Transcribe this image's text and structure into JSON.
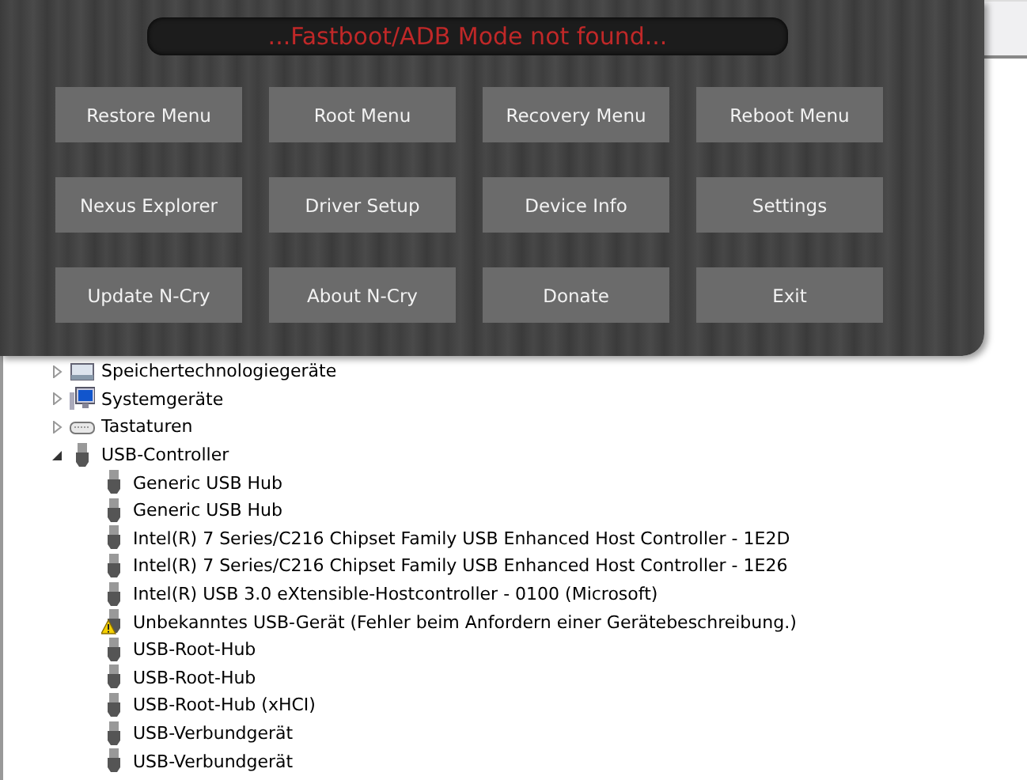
{
  "status": "...Fastboot/ADB Mode not found...",
  "buttons": [
    "Restore Menu",
    "Root Menu",
    "Recovery Menu",
    "Reboot Menu",
    "Nexus Explorer",
    "Driver Setup",
    "Device Info",
    "Settings",
    "Update N-Cry",
    "About N-Cry",
    "Donate",
    "Exit"
  ],
  "tree": [
    {
      "label": "Speichertechnologiegeräte",
      "kind": "storage",
      "expanded": false
    },
    {
      "label": "Systemgeräte",
      "kind": "system",
      "expanded": false
    },
    {
      "label": "Tastaturen",
      "kind": "keyboard",
      "expanded": false
    },
    {
      "label": "USB-Controller",
      "kind": "usb",
      "expanded": true,
      "children": [
        {
          "label": "Generic USB Hub",
          "warning": false
        },
        {
          "label": "Generic USB Hub",
          "warning": false
        },
        {
          "label": "Intel(R) 7 Series/C216 Chipset Family USB Enhanced Host Controller - 1E2D",
          "warning": false
        },
        {
          "label": "Intel(R) 7 Series/C216 Chipset Family USB Enhanced Host Controller - 1E26",
          "warning": false
        },
        {
          "label": "Intel(R) USB 3.0 eXtensible-Hostcontroller - 0100 (Microsoft)",
          "warning": false
        },
        {
          "label": "Unbekanntes USB-Gerät (Fehler beim Anfordern einer Gerätebeschreibung.)",
          "warning": true
        },
        {
          "label": "USB-Root-Hub",
          "warning": false
        },
        {
          "label": "USB-Root-Hub",
          "warning": false
        },
        {
          "label": "USB-Root-Hub (xHCI)",
          "warning": false
        },
        {
          "label": "USB-Verbundgerät",
          "warning": false
        },
        {
          "label": "USB-Verbundgerät",
          "warning": false
        }
      ]
    }
  ]
}
